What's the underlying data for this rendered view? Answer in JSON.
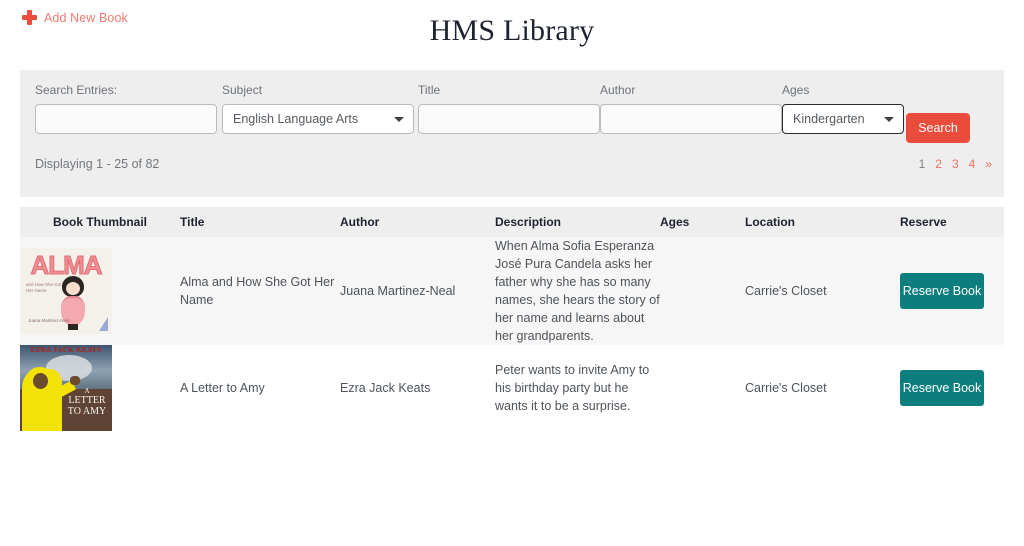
{
  "header": {
    "add_new_book_label": "Add New Book",
    "add_icon": "plus-icon",
    "title": "HMS Library"
  },
  "search": {
    "fields": [
      {
        "label": "Search Entries:",
        "type": "text",
        "value": "",
        "placeholder": ""
      },
      {
        "label": "Subject",
        "type": "select",
        "value": "English Language Arts"
      },
      {
        "label": "Title",
        "type": "text",
        "value": "",
        "placeholder": ""
      },
      {
        "label": "Author",
        "type": "text",
        "value": "",
        "placeholder": ""
      },
      {
        "label": "Ages",
        "type": "select",
        "value": "Kindergarten"
      }
    ],
    "search_button_label": "Search",
    "search_button_color": "#ea4c3b"
  },
  "results": {
    "displaying_text": "Displaying 1 - 25 of 82",
    "range_start": 1,
    "range_end": 25,
    "total": 82,
    "pagination": [
      {
        "label": "1",
        "current": true
      },
      {
        "label": "2",
        "current": false
      },
      {
        "label": "3",
        "current": false
      },
      {
        "label": "4",
        "current": false
      },
      {
        "label": "»",
        "current": false
      }
    ]
  },
  "table": {
    "columns": [
      "Book Thumbnail",
      "Title",
      "Author",
      "Description",
      "Ages",
      "Location",
      "Reserve"
    ],
    "rows": [
      {
        "thumbnail_alt": "Alma and How She Got Her Name book cover",
        "cover_title": "ALMA",
        "cover_subtitle": "and How She Got Her Name",
        "cover_author": "Juana Martinez-Neal",
        "title": "Alma and How She Got Her Name",
        "author": "Juana Martinez-Neal",
        "description": "When Alma Sofia Esperanza José Pura Candela asks her father why she has so many names, she hears the story of her name and learns about her grandparents.",
        "ages": "",
        "location": "Carrie's Closet",
        "reserve_label": "Reserve Book"
      },
      {
        "thumbnail_alt": "A Letter to Amy book cover",
        "cover_headline": "EZRA JACK KEATS",
        "cover_title_line1": "A",
        "cover_title_line2": "LETTER",
        "cover_title_line3": "TO AMY",
        "title": "A Letter to Amy",
        "author": "Ezra Jack Keats",
        "description": "Peter wants to invite Amy to his birthday party but he wants it to be a surprise.",
        "ages": "",
        "location": "Carrie's Closet",
        "reserve_label": "Reserve Book"
      }
    ]
  },
  "colors": {
    "accent_red": "#ea4c3b",
    "link_red": "#ef6d5f",
    "reserve_teal": "#0b7e7d",
    "panel_gray": "#eeeeee"
  }
}
